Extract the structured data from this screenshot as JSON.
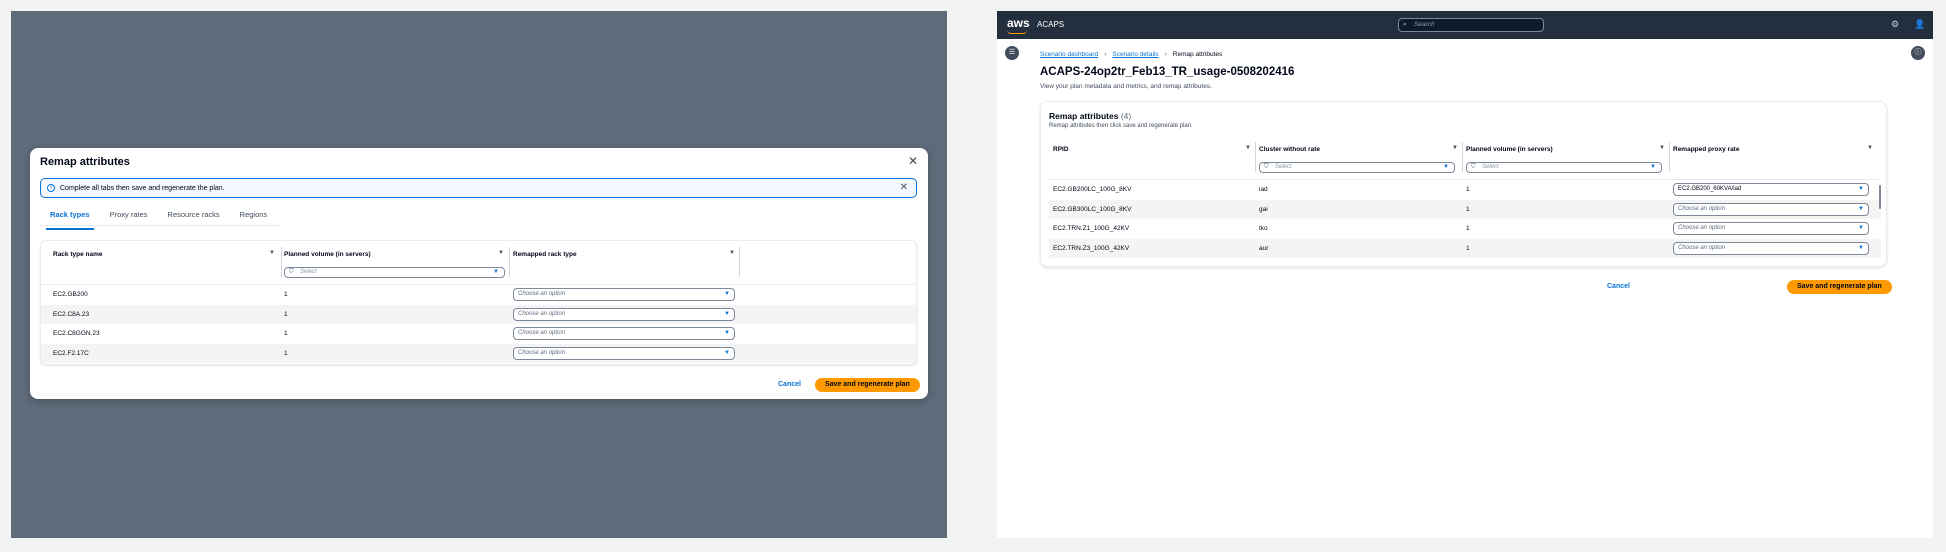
{
  "left": {
    "modal": {
      "title": "Remap attributes",
      "alert_text": "Complete all tabs then save and regenerate the plan.",
      "tabs": [
        "Rack types",
        "Proxy rates",
        "Resource racks",
        "Regions"
      ],
      "columns": [
        "Rack type name",
        "Planned volume (in servers)",
        "Remapped rack type"
      ],
      "filter_placeholder": "Select",
      "rows": [
        {
          "name": "EC2.GB200",
          "volume": "1",
          "remap": "Choose an option"
        },
        {
          "name": "EC2.C8A.23",
          "volume": "1",
          "remap": "Choose an option"
        },
        {
          "name": "EC2.C8GGN.23",
          "volume": "1",
          "remap": "Choose an option"
        },
        {
          "name": "EC2.F2.17C",
          "volume": "1",
          "remap": "Choose an option"
        }
      ],
      "cancel_label": "Cancel",
      "save_label": "Save and regenerate plan"
    }
  },
  "right": {
    "nav": {
      "logo_text": "aws",
      "app_name": "ACAPS",
      "search_placeholder": "Search"
    },
    "breadcrumbs": [
      "Scenario dashboard",
      "Scenario details",
      "Remap attributes"
    ],
    "page_title": "ACAPS-24op2tr_Feb13_TR_usage-0508202416",
    "page_desc": "View your plan metadata and metrics, and remap attributes.",
    "card": {
      "title": "Remap attributes",
      "count": "(4)",
      "desc": "Remap attributes then click save and regenerate plan.",
      "columns": [
        "RPID",
        "Cluster without rate",
        "Planned volume (in servers)",
        "Remapped proxy rate"
      ],
      "filter_placeholder": "Select",
      "rows": [
        {
          "rpid": "EC2.GB200LC_100G_8KV",
          "cluster": "iad",
          "volume": "1",
          "remap": "EC2.GB200_60KVA/iad",
          "filled": true
        },
        {
          "rpid": "EC2.GB300LC_100G_8KV",
          "cluster": "gai",
          "volume": "1",
          "remap": "Choose an option",
          "filled": false
        },
        {
          "rpid": "EC2.TRN.Z1_100G_42KV",
          "cluster": "tko",
          "volume": "1",
          "remap": "Choose an option",
          "filled": false
        },
        {
          "rpid": "EC2.TRN.Z3_100G_42KV",
          "cluster": "aur",
          "volume": "1",
          "remap": "Choose an option",
          "filled": false
        }
      ]
    },
    "cancel_label": "Cancel",
    "save_label": "Save and regenerate plan"
  },
  "colors": {
    "accent": "#0972d3",
    "primary_button": "#ff9900",
    "overlay": "#5f6b7a",
    "navbar": "#232f3e"
  },
  "icons": [
    "close-icon",
    "info-icon",
    "filter-icon",
    "caret-down-icon",
    "search-icon",
    "settings-icon",
    "user-icon",
    "menu-icon",
    "help-icon",
    "chevron-right-icon"
  ]
}
